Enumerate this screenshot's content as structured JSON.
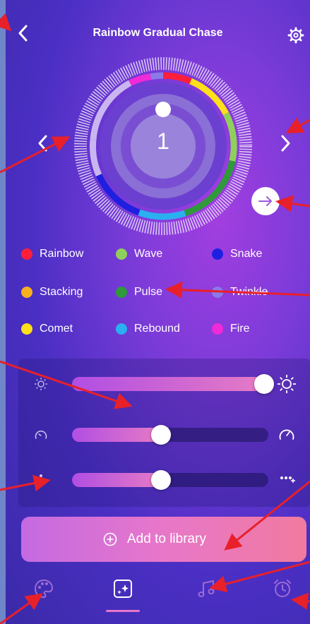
{
  "header": {
    "title": "Rainbow Gradual Chase",
    "back_icon": "chevron-left-icon",
    "settings_icon": "gear-icon"
  },
  "dial": {
    "value": "1",
    "prev_icon": "chevron-left-icon",
    "next_icon": "chevron-right-icon",
    "direction_icon": "arrow-right-icon"
  },
  "effects": [
    {
      "label": "Rainbow",
      "color": "#ff1f3a"
    },
    {
      "label": "Wave",
      "color": "#8fd05a"
    },
    {
      "label": "Snake",
      "color": "#1f1fe0"
    },
    {
      "label": "Stacking",
      "color": "#f7b01e"
    },
    {
      "label": "Pulse",
      "color": "#2e9a3a"
    },
    {
      "label": "Twinkle",
      "color": "#8a7ae8"
    },
    {
      "label": "Comet",
      "color": "#ffe01a"
    },
    {
      "label": "Rebound",
      "color": "#2ab0f0"
    },
    {
      "label": "Fire",
      "color": "#f02ad8"
    }
  ],
  "sliders": [
    {
      "name": "brightness",
      "left_icon": "sun-small-icon",
      "right_icon": "sun-large-icon",
      "value_fraction": 1.0
    },
    {
      "name": "speed",
      "left_icon": "gauge-slow-icon",
      "right_icon": "gauge-fast-icon",
      "value_fraction": 0.45
    },
    {
      "name": "length",
      "left_icon": "dots-few-icon",
      "right_icon": "dots-more-icon",
      "value_fraction": 0.45
    }
  ],
  "add_button": {
    "label": "Add to library",
    "icon": "plus-circle-icon"
  },
  "tabbar": [
    {
      "name": "scenes",
      "icon": "palette-icon",
      "active": false
    },
    {
      "name": "effects",
      "icon": "sparkle-frame-icon",
      "active": true
    },
    {
      "name": "music",
      "icon": "music-note-icon",
      "active": false
    },
    {
      "name": "timer",
      "icon": "alarm-clock-icon",
      "active": false
    }
  ],
  "colors": {
    "annotation_arrow": "#e8202a",
    "accent_pink": "#e877c9"
  }
}
